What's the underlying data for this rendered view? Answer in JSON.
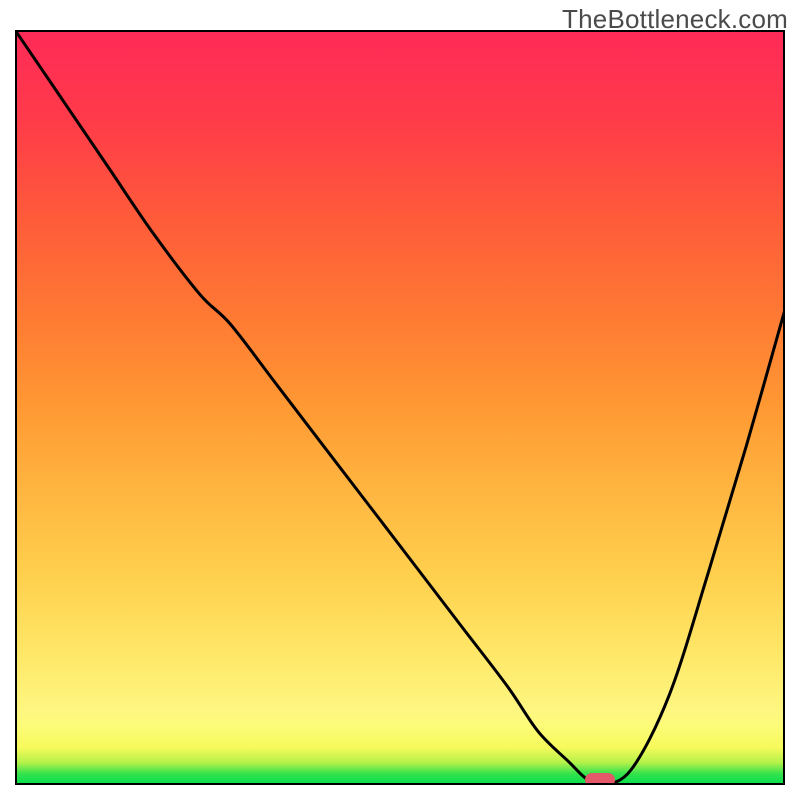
{
  "watermark": {
    "text": "TheBottleneck.com"
  },
  "colors": {
    "gradient_top": "#ff2a58",
    "gradient_mid": "#ffcf4d",
    "gradient_low": "#fdfb7a",
    "gradient_bottom": "#00e04e",
    "curve": "#000000",
    "marker": "#e4586a",
    "frame": "#000000"
  },
  "chart_data": {
    "type": "line",
    "title": "",
    "xlabel": "",
    "ylabel": "",
    "xlim": [
      0,
      100
    ],
    "ylim": [
      0,
      100
    ],
    "grid": false,
    "background_gradient": "bottleneck-heat",
    "series": [
      {
        "name": "bottleneck-curve",
        "x": [
          0,
          6,
          12,
          18,
          24,
          28,
          34,
          40,
          46,
          52,
          58,
          64,
          68,
          72,
          74,
          76,
          80,
          85,
          90,
          95,
          100
        ],
        "values": [
          100,
          91,
          82,
          73,
          65,
          61,
          53,
          45,
          37,
          29,
          21,
          13,
          7,
          3,
          1,
          0,
          2,
          12,
          28,
          45,
          63
        ]
      }
    ],
    "marker": {
      "x": 76,
      "y": 0.7,
      "shape": "pill"
    }
  }
}
